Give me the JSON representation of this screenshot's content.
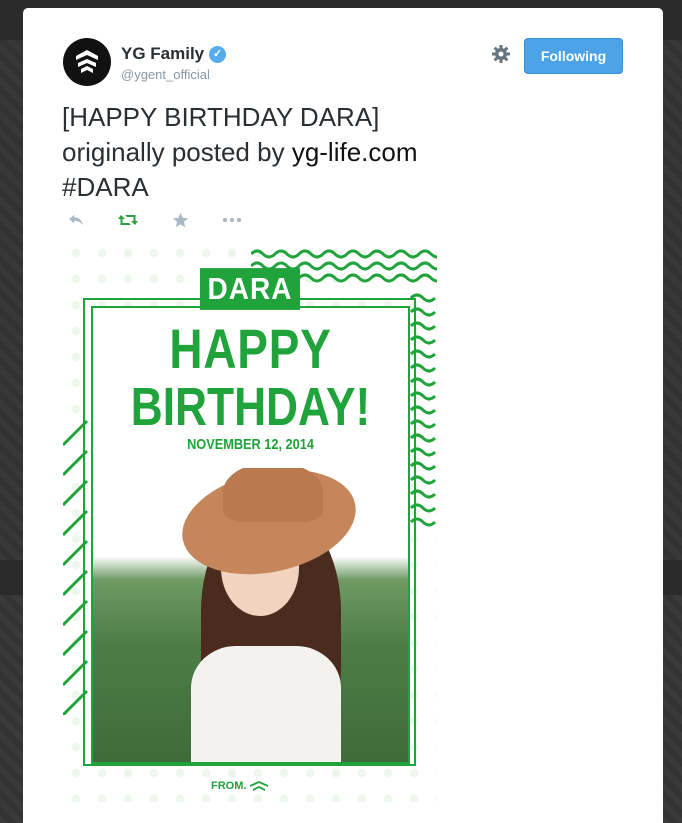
{
  "account": {
    "name": "YG Family",
    "handle": "@ygent_official",
    "follow_label": "Following"
  },
  "tweet": {
    "line1": "[HAPPY BIRTHDAY DARA]",
    "line2_prefix": "originally posted by ",
    "line2_link": "yg-life.com",
    "line3": "#DARA"
  },
  "poster": {
    "tag": "DARA",
    "headline1": "HAPPY",
    "headline2": "BIRTHDAY!",
    "date": "NOVEMBER 12, 2014",
    "from": "FROM."
  },
  "colors": {
    "accent_green": "#1fa33a",
    "follow_blue": "#4ca3e8",
    "verified_blue": "#55acee"
  },
  "icons": [
    "yg-logo-icon",
    "verified-icon",
    "gear-icon",
    "reply-icon",
    "retweet-icon",
    "favorite-icon",
    "more-icon"
  ]
}
